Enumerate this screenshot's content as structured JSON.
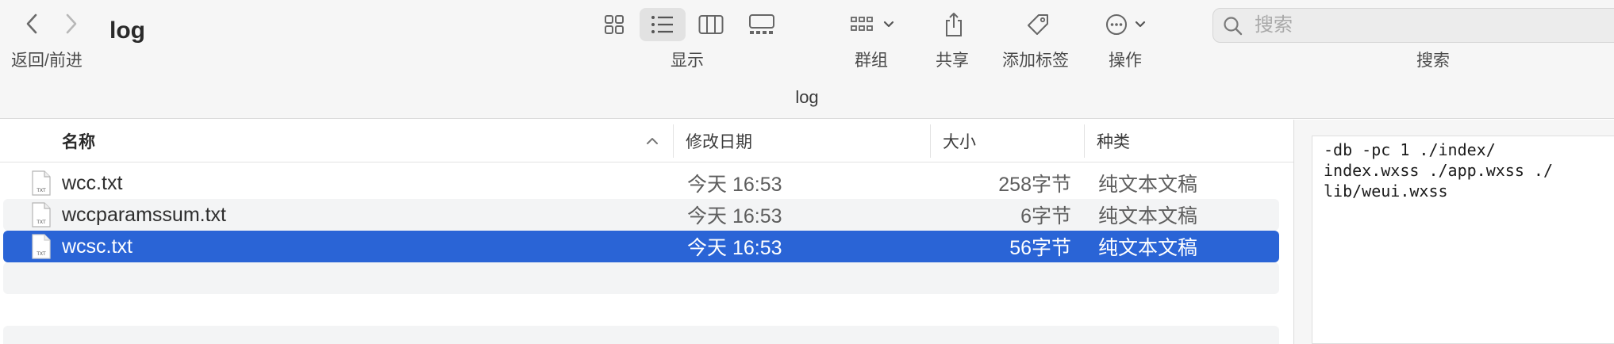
{
  "window": {
    "title": "log",
    "path_title": "log"
  },
  "toolbar": {
    "nav_label": "返回/前进",
    "view_label": "显示",
    "group_label": "群组",
    "share_label": "共享",
    "tags_label": "添加标签",
    "action_label": "操作",
    "search_label": "搜索",
    "search_placeholder": "搜索"
  },
  "columns": {
    "name": "名称",
    "date": "修改日期",
    "size": "大小",
    "kind": "种类"
  },
  "files": [
    {
      "name": "wcc.txt",
      "date": "今天 16:53",
      "size": "258字节",
      "kind": "纯文本文稿",
      "selected": false
    },
    {
      "name": "wccparamssum.txt",
      "date": "今天 16:53",
      "size": "6字节",
      "kind": "纯文本文稿",
      "selected": false
    },
    {
      "name": "wcsc.txt",
      "date": "今天 16:53",
      "size": "56字节",
      "kind": "纯文本文稿",
      "selected": true
    }
  ],
  "file_icon_label": "TXT",
  "preview": {
    "text": "-db -pc 1 ./index/\nindex.wxss ./app.wxss ./\nlib/weui.wxss"
  },
  "colors": {
    "selection": "#2a64d6",
    "toolbar_bg": "#f6f6f6",
    "alt_row": "#f3f4f5"
  }
}
